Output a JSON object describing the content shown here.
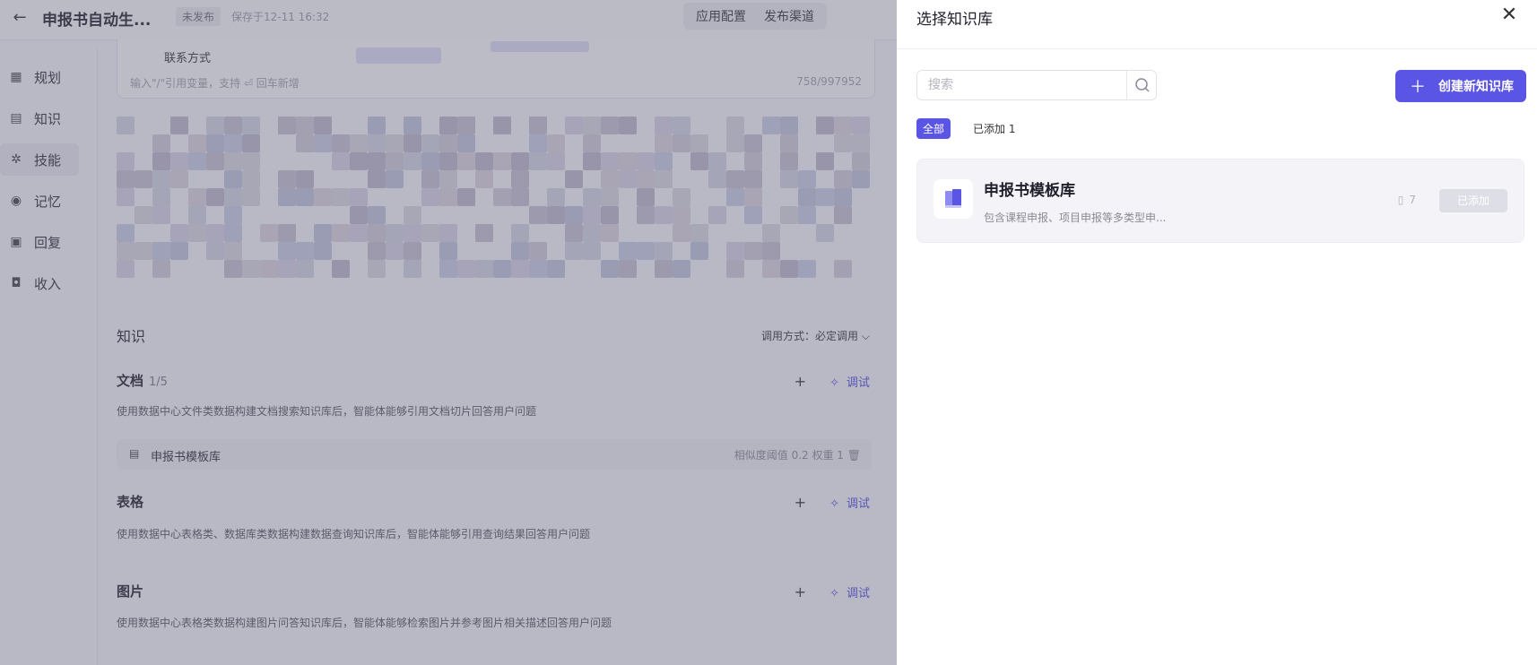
{
  "app": {
    "title": "申报书自动生...",
    "status_badge": "未发布",
    "saved_text": "保存于12-11 16:32",
    "tabs": [
      "应用配置",
      "发布渠道"
    ]
  },
  "nav": {
    "items": [
      {
        "label": "规划",
        "icon": "grid-icon"
      },
      {
        "label": "知识",
        "icon": "book-icon"
      },
      {
        "label": "技能",
        "icon": "skill-icon"
      },
      {
        "label": "记忆",
        "icon": "memory-icon"
      },
      {
        "label": "回复",
        "icon": "reply-icon"
      },
      {
        "label": "收入",
        "icon": "bag-icon"
      }
    ],
    "active_index": 2
  },
  "prompt": {
    "var_line_label": "联系方式",
    "hint": "输入\"/\"引用变量，支持 ⏎ 回车新增",
    "count": "758/997952"
  },
  "knowledge": {
    "title": "知识",
    "call_mode": "调用方式：必定调用",
    "doc": {
      "title": "文档",
      "count": "1/5",
      "desc": "使用数据中心文件类数据构建文档搜索知识库后，智能体能够引用文档切片回答用户问题",
      "item_name": "申报书模板库",
      "item_meta": "相似度阈值  0.2    权重  1"
    },
    "table": {
      "title": "表格",
      "desc": "使用数据中心表格类、数据库类数据构建数据查询知识库后，智能体能够引用查询结果回答用户问题"
    },
    "image": {
      "title": "图片",
      "desc": "使用数据中心表格类数据构建图片问答知识库后，智能体能够检索图片并参考图片相关描述回答用户问题"
    },
    "add_label": "+",
    "debug_label": "调试"
  },
  "drawer": {
    "title": "选择知识库",
    "search_placeholder": "搜索",
    "create_button": "创建新知识库",
    "filters": [
      "全部",
      "已添加 1"
    ],
    "card": {
      "name": "申报书模板库",
      "desc": "包含课程申报、项目申报等多类型申...",
      "doc_count": "7",
      "button": "已添加"
    }
  },
  "colors": {
    "accent": "#5b55e6",
    "overlay": "#64647d"
  }
}
